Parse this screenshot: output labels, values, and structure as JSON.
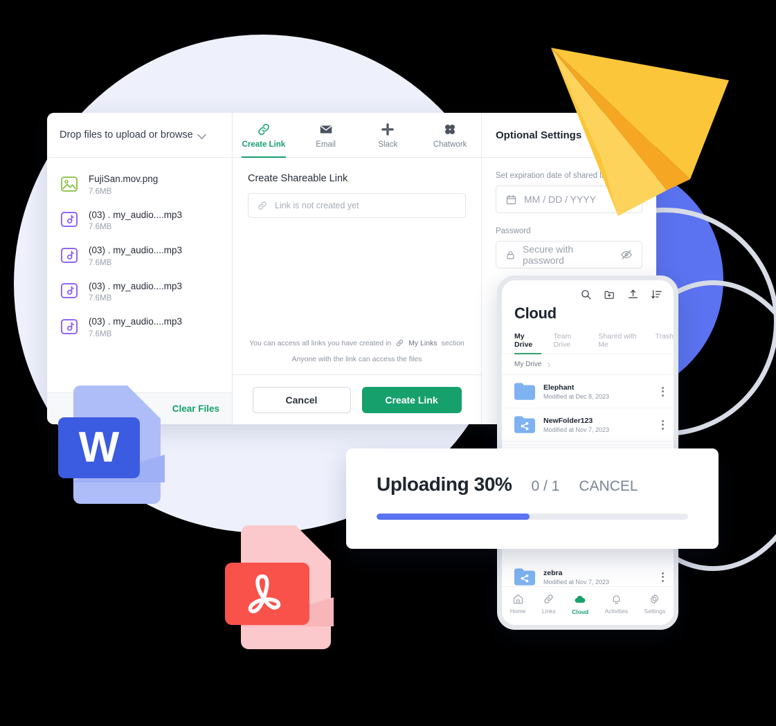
{
  "colors": {
    "brand_green": "#16A06C",
    "accent_blue": "#5B73F0",
    "pale_circle": "#EEF1FC",
    "plane_yellow": "#FCC63A",
    "plane_shadow": "#F5A623",
    "pdf_red": "#F9524B",
    "word_blue": "#3B5BE0"
  },
  "dialog": {
    "files_panel": {
      "header_label": "Drop files to upload or browse",
      "header_icon": "chevron-down-icon",
      "files": [
        {
          "name": "FujiSan.mov.png",
          "size": "7.6MB",
          "icon": "image-file-icon",
          "icon_color": "#8BC34A"
        },
        {
          "name": "(03) . my_audio....mp3",
          "size": "7.6MB",
          "icon": "audio-file-icon",
          "icon_color": "#8B5CF6"
        },
        {
          "name": "(03) . my_audio....mp3",
          "size": "7.6MB",
          "icon": "audio-file-icon",
          "icon_color": "#8B5CF6"
        },
        {
          "name": "(03) . my_audio....mp3",
          "size": "7.6MB",
          "icon": "audio-file-icon",
          "icon_color": "#8B5CF6"
        },
        {
          "name": "(03) . my_audio....mp3",
          "size": "7.6MB",
          "icon": "audio-file-icon",
          "icon_color": "#8B5CF6"
        }
      ],
      "clear_files_label": "Clear Files"
    },
    "share_tabs": [
      {
        "label": "Create Link",
        "icon": "link-icon",
        "active": true
      },
      {
        "label": "Email",
        "icon": "envelope-icon",
        "active": false
      },
      {
        "label": "Slack",
        "icon": "slack-icon",
        "active": false
      },
      {
        "label": "Chatwork",
        "icon": "chatwork-icon",
        "active": false
      }
    ],
    "create_link": {
      "section_title": "Create Shareable Link",
      "link_field_placeholder": "Link is not created yet",
      "link_field_icon": "link-icon",
      "note_prefix": "You can access all links you have created in",
      "note_link_label": "My Links",
      "note_suffix": "section",
      "note_secondary": "Anyone with the link can access the files",
      "cancel_label": "Cancel",
      "create_label": "Create Link"
    },
    "optional_settings": {
      "title": "Optional Settings",
      "expiration_label": "Set expiration date of shared link",
      "expiration_placeholder": "MM / DD / YYYY",
      "expiration_icon": "calendar-icon",
      "password_label": "Password",
      "password_placeholder": "Secure with password",
      "password_icon": "lock-icon",
      "password_toggle_icon": "eye-off-icon"
    }
  },
  "phone": {
    "toolbar_icons": [
      "search-icon",
      "new-folder-icon",
      "upload-icon",
      "sort-icon"
    ],
    "app_title": "Cloud",
    "tabs": [
      {
        "label": "My Drive",
        "active": true
      },
      {
        "label": "Team Drive",
        "active": false
      },
      {
        "label": "Shared with Me",
        "active": false
      },
      {
        "label": "Trash",
        "active": false
      }
    ],
    "breadcrumb": "My Drive",
    "breadcrumb_icon": "chevron-right-icon",
    "rows": [
      {
        "name": "Elephant",
        "modified": "Modified at Dec 8, 2023",
        "icon": "folder-icon"
      },
      {
        "name": "NewFolder123",
        "modified": "Modified at Nov 7, 2023",
        "icon": "shared-folder-icon"
      },
      {
        "name": "zebra",
        "modified": "Modified at Nov 7, 2023",
        "icon": "shared-folder-icon"
      }
    ],
    "nav": [
      {
        "label": "Home",
        "icon": "home-icon",
        "active": false
      },
      {
        "label": "Links",
        "icon": "link-icon",
        "active": false
      },
      {
        "label": "Cloud",
        "icon": "cloud-icon",
        "active": true
      },
      {
        "label": "Activities",
        "icon": "bell-icon",
        "active": false
      },
      {
        "label": "Settings",
        "icon": "gear-icon",
        "active": false
      }
    ]
  },
  "upload_card": {
    "title": "Uploading 30%",
    "count": "0 / 1",
    "cancel_label": "CANCEL",
    "progress_percent": 49
  },
  "decor": {
    "word_doc_icon": "word-document-icon",
    "word_letter": "W",
    "pdf_doc_icon": "pdf-document-icon",
    "paper_plane_icon": "paper-plane-icon"
  }
}
